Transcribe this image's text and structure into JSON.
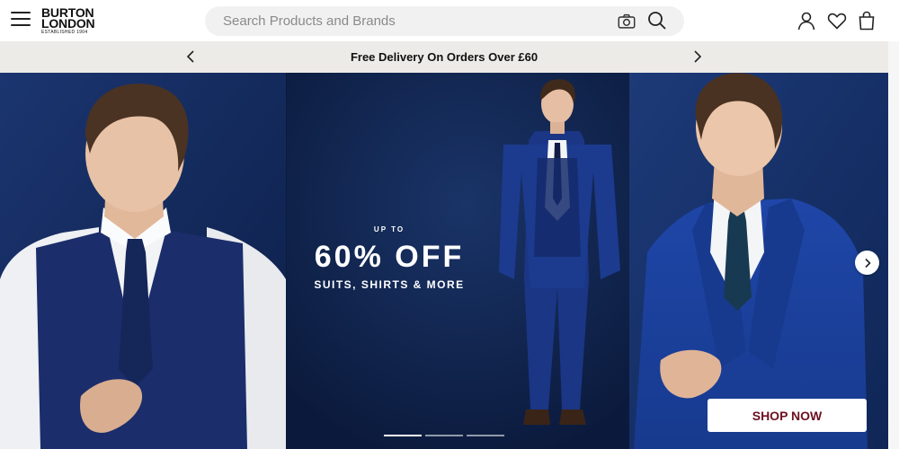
{
  "header": {
    "logo": {
      "line1": "BURTON",
      "line2": "LONDON",
      "line3": "ESTABLISHED 1904"
    },
    "search": {
      "placeholder": "Search Products and Brands"
    },
    "icons": [
      "menu-icon",
      "camera-icon",
      "search-icon",
      "account-icon",
      "wishlist-icon",
      "bag-icon"
    ]
  },
  "promo": {
    "text": "Free Delivery On Orders Over £60"
  },
  "hero": {
    "eyebrow": "UP TO",
    "headline": "60% OFF",
    "subline": "SUITS, SHIRTS & MORE",
    "cta": "SHOP NOW",
    "slides": 3,
    "active_slide": 1
  },
  "colors": {
    "navy": "#0f2450",
    "promo_bg": "#edebe7",
    "cta_text": "#6b1020"
  }
}
